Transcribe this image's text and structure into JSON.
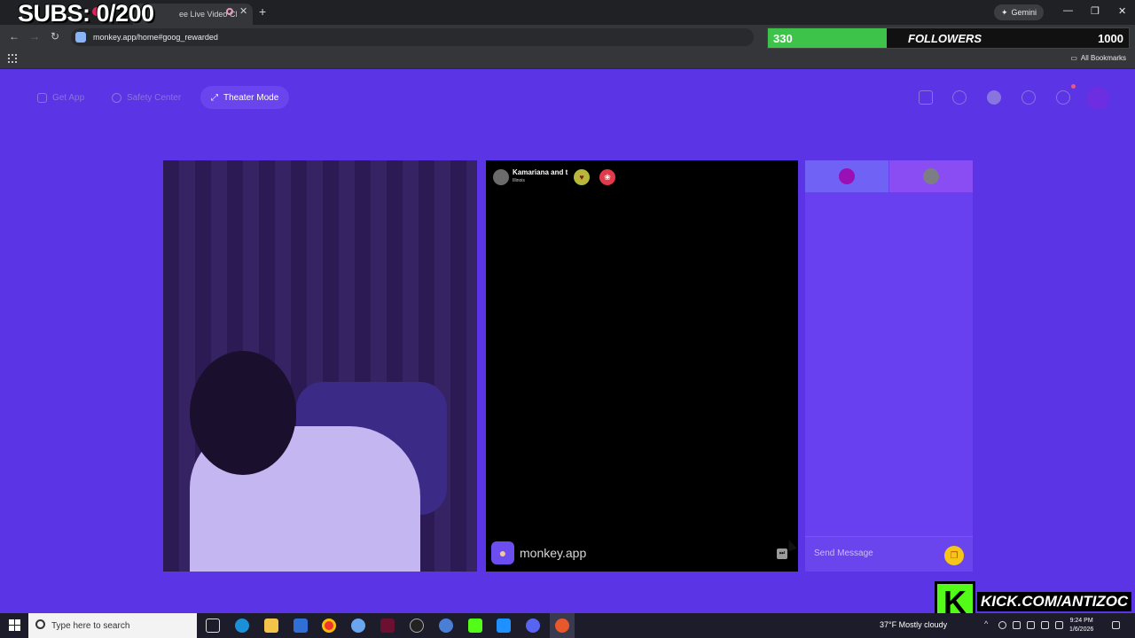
{
  "browser": {
    "tab_title": "ee Live Video Cl",
    "url": "monkey.app/home#goog_rewarded",
    "gemini_label": "Gemini",
    "all_bookmarks_label": "All Bookmarks"
  },
  "stream_overlay": {
    "subs_text": "SUBS: 0/200",
    "followers_count": "330",
    "followers_label": "FOLLOWERS",
    "followers_goal": "1000",
    "followers_progress": 0.33,
    "kick_text": "KICK.COM/ANTIZOC",
    "kick_logo": "K"
  },
  "app_nav": {
    "get_app": "Get App",
    "safety_center": "Safety Center",
    "theater_mode": "Theater Mode"
  },
  "peer": {
    "name": "Kamariana and t",
    "location": "Illinois"
  },
  "brand": {
    "name": "monkey.app"
  },
  "chat": {
    "send_placeholder": "Send Message"
  },
  "taskbar": {
    "search_placeholder": "Type here to search",
    "weather": "37°F  Mostly cloudy",
    "time": "9:24 PM",
    "date": "1/6/2026"
  },
  "colors": {
    "app_bg": "#5b34e6",
    "follow_fill": "#3ec34a",
    "kick_green": "#53fc18"
  },
  "icons": [
    "back-icon",
    "forward-icon",
    "reload-icon",
    "search-icon",
    "history-icon",
    "chat-icon",
    "gift-icon",
    "heart-icon",
    "skip-icon"
  ]
}
